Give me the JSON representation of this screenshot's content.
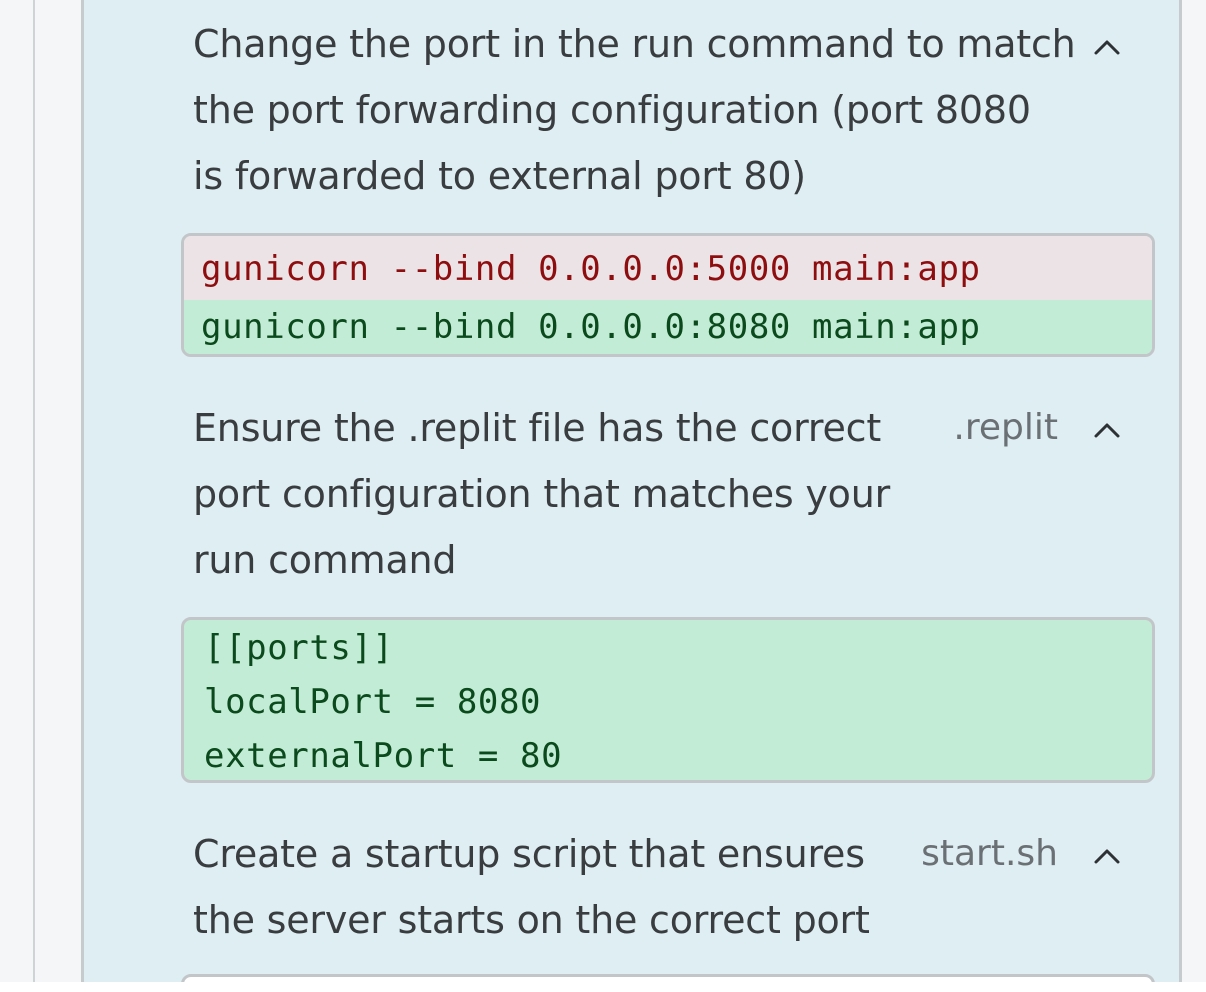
{
  "steps": [
    {
      "lines": [
        "Change the port in the run command to match",
        "the port forwarding configuration (port 8080",
        "is forwarded to external port 80)"
      ],
      "file": "",
      "icon": "chevron-up-icon",
      "diff": {
        "removed": [
          "gunicorn --bind 0.0.0.0:5000 main:app"
        ],
        "added": [
          "gunicorn --bind 0.0.0.0:8080 main:app"
        ]
      }
    },
    {
      "lines": [
        "Ensure the .replit file has the correct",
        "port configuration that matches your",
        "run command"
      ],
      "file": ".replit",
      "icon": "chevron-up-icon",
      "diff": {
        "removed": [],
        "added": [
          "[[ports]]",
          "localPort = 8080",
          "externalPort = 80"
        ]
      }
    },
    {
      "lines": [
        "Create a startup script that ensures",
        "the server starts on the correct port"
      ],
      "file": "start.sh",
      "icon": "chevron-up-icon"
    }
  ],
  "colors": {
    "panel_bg": "#deeef2",
    "removed_bg": "#ebe3e6",
    "removed_text": "#8e0e10",
    "added_bg": "#c2ecd5",
    "added_text": "#0b4a1c"
  }
}
